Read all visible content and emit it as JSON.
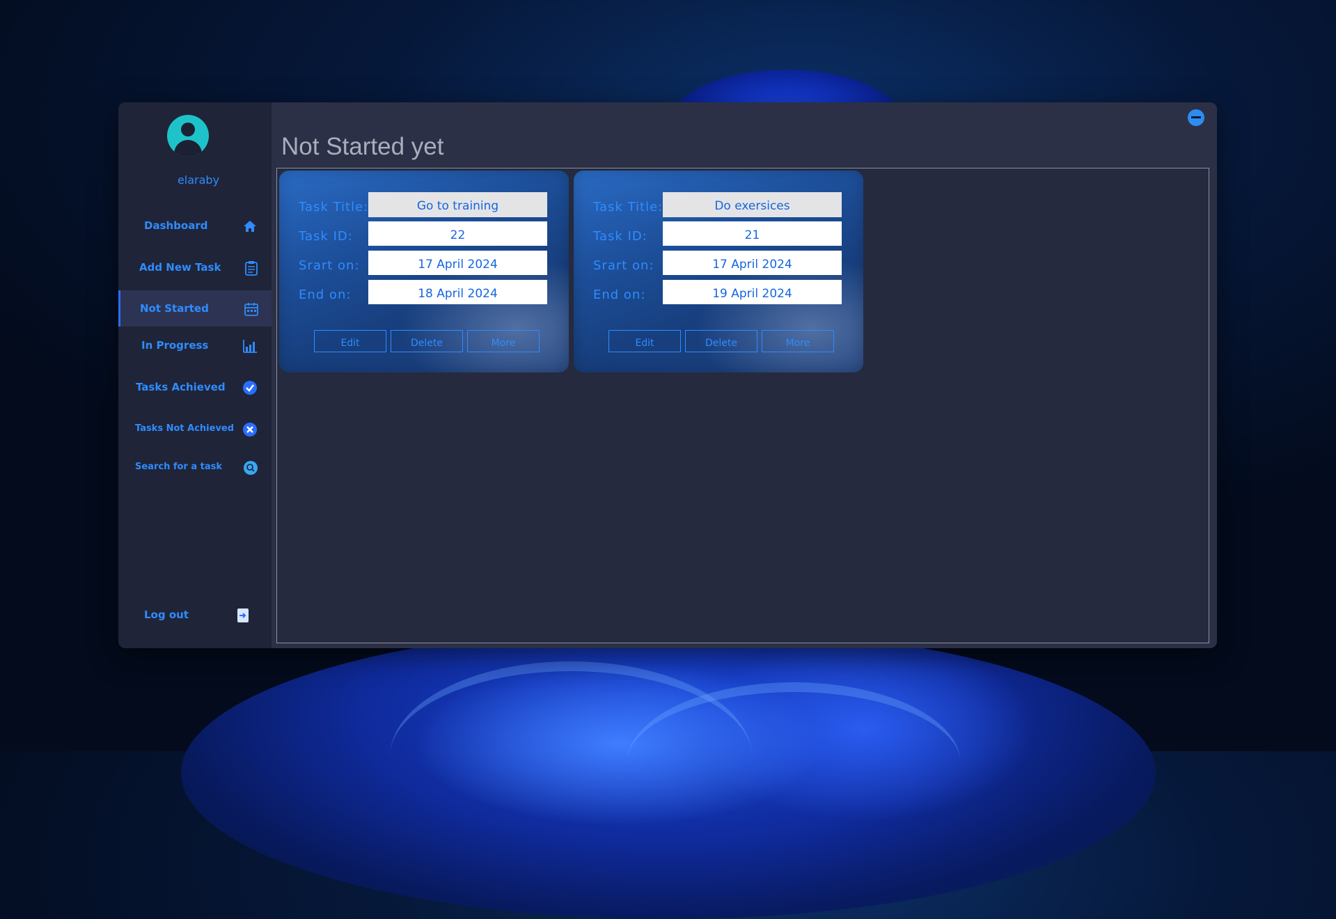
{
  "sidebar": {
    "username": "elaraby",
    "items": [
      {
        "label": "Dashboard",
        "icon": "home-icon"
      },
      {
        "label": "Add New Task",
        "icon": "clipboard-icon"
      },
      {
        "label": "Not Started",
        "icon": "calendar-icon",
        "active": true
      },
      {
        "label": "In Progress",
        "icon": "chart-icon"
      },
      {
        "label": "Tasks Achieved",
        "icon": "check-circle-icon"
      },
      {
        "label": "Tasks Not Achieved",
        "icon": "x-circle-icon"
      },
      {
        "label": "Search for a task",
        "icon": "search-icon"
      }
    ],
    "logout_label": "Log out"
  },
  "main": {
    "title": "Not Started yet"
  },
  "labels": {
    "title": "Task Title:",
    "id": "Task ID:",
    "start": "Srart on:",
    "end": "End on:"
  },
  "buttons": {
    "edit": "Edit",
    "delete": "Delete",
    "more": "More"
  },
  "tasks": [
    {
      "title": "Go to training",
      "id": "22",
      "start": "17 April 2024",
      "end": "18 April 2024"
    },
    {
      "title": "Do exersices",
      "id": "21",
      "start": "17 April 2024",
      "end": "19 April 2024"
    }
  ],
  "colors": {
    "accent": "#2f8cff",
    "sidebar_bg": "#1f2438",
    "main_bg": "#2b3046",
    "avatar": "#1ec3c9"
  }
}
